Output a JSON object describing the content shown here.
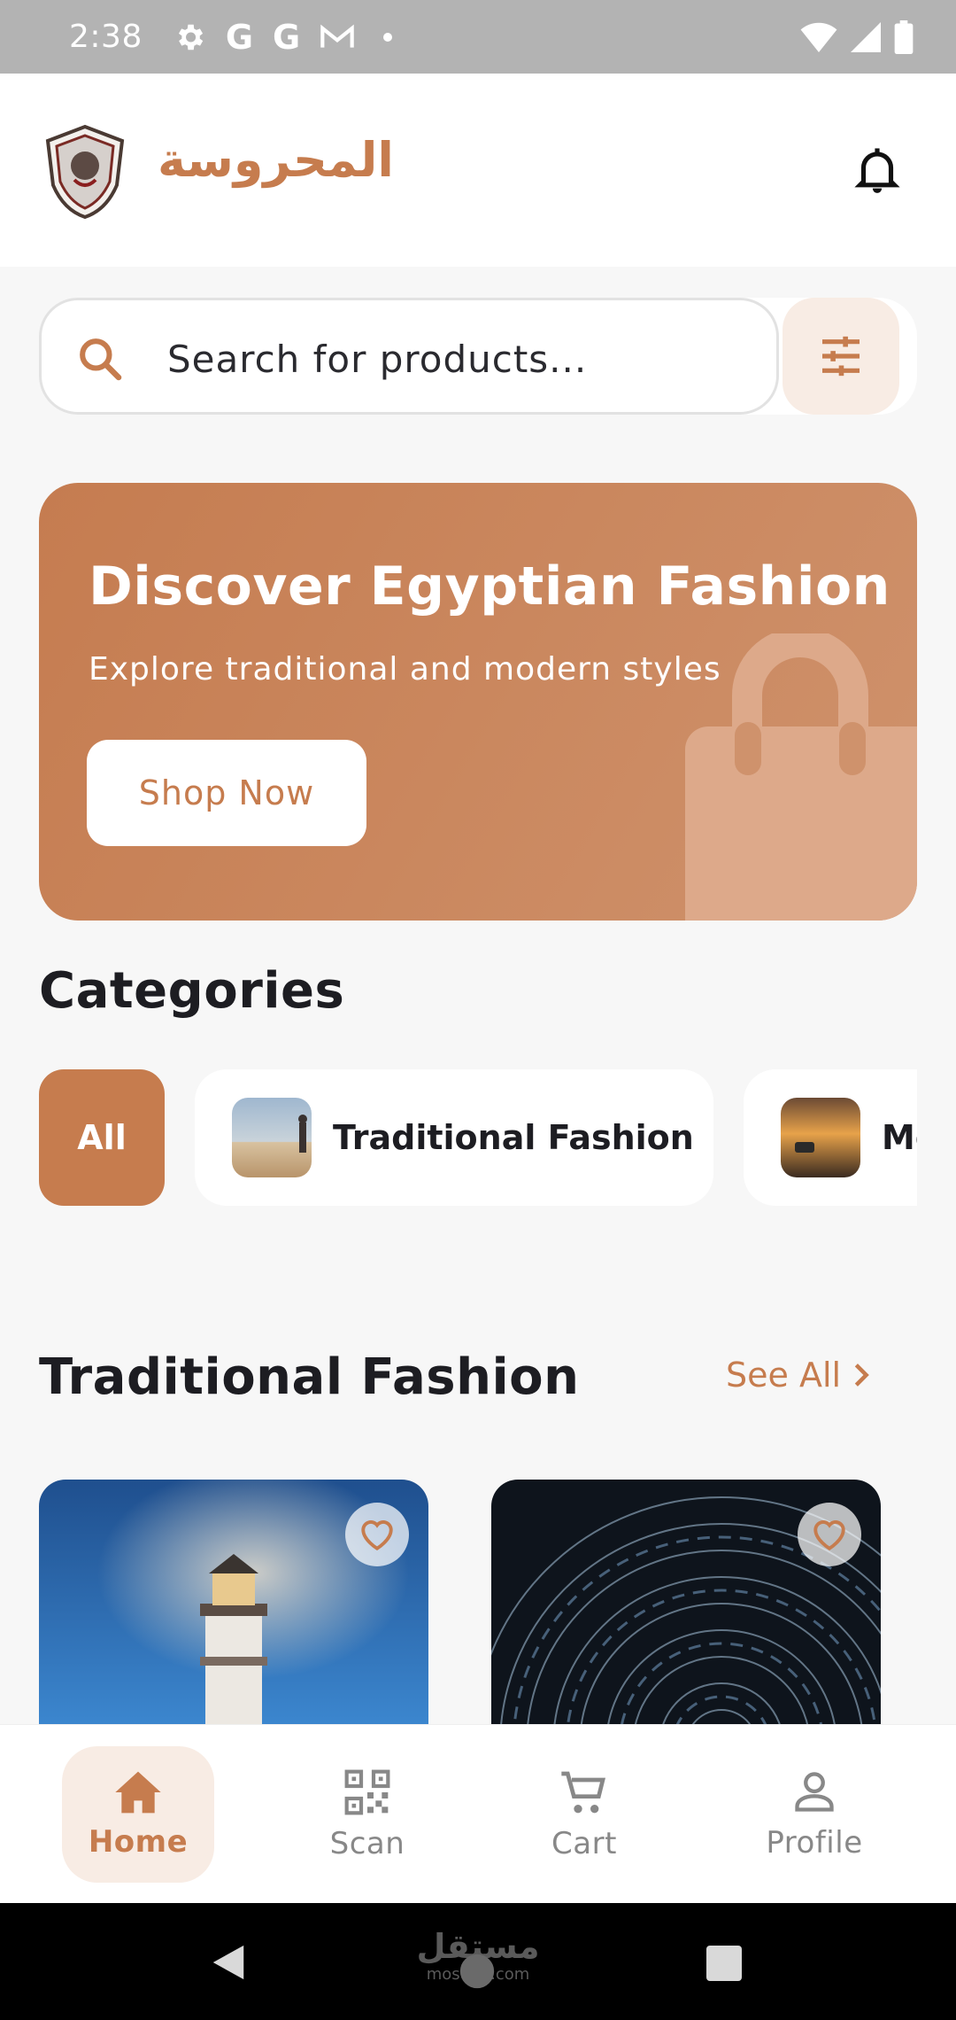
{
  "status_bar": {
    "time": "2:38",
    "icons": [
      "gear-icon",
      "google-icon",
      "google-icon",
      "gmail-icon",
      "dot-icon",
      "wifi-icon",
      "signal-icon",
      "battery-icon"
    ],
    "g1": "G",
    "g2": "G"
  },
  "header": {
    "brand": "المحروسة",
    "logo_icon": "crest-logo",
    "notification_icon": "bell-icon"
  },
  "search": {
    "placeholder": "Search for products...",
    "value": "",
    "filter_icon": "sliders-icon"
  },
  "banner": {
    "title": "Discover Egyptian Fashion",
    "subtitle": "Explore traditional and modern styles",
    "button_label": "Shop Now",
    "decor_icon": "shopping-bag-icon"
  },
  "categories": {
    "title": "Categories",
    "items": [
      {
        "label": "All",
        "selected": true
      },
      {
        "label": "Traditional Fashion",
        "selected": false
      },
      {
        "label": "Mo",
        "selected": false
      }
    ]
  },
  "section": {
    "title": "Traditional Fashion",
    "see_all_label": "See All"
  },
  "products": [
    {
      "image": "lighthouse-photo",
      "favorite_icon": "heart-outline-icon"
    },
    {
      "image": "star-trails-photo",
      "favorite_icon": "heart-outline-icon"
    }
  ],
  "bottom_nav": {
    "items": [
      {
        "label": "Home",
        "icon": "home-icon",
        "active": true
      },
      {
        "label": "Scan",
        "icon": "qr-scan-icon",
        "active": false
      },
      {
        "label": "Cart",
        "icon": "cart-icon",
        "active": false
      },
      {
        "label": "Profile",
        "icon": "person-icon",
        "active": false
      }
    ]
  },
  "system_nav": {
    "watermark_ar": "مستقل",
    "watermark_en": "mostaql.com"
  },
  "colors": {
    "accent": "#C67C4E",
    "accent_light": "#F8ECE4",
    "background": "#F7F7F7",
    "text": "#1D1D22",
    "status_bar": "#B3B3B3"
  }
}
